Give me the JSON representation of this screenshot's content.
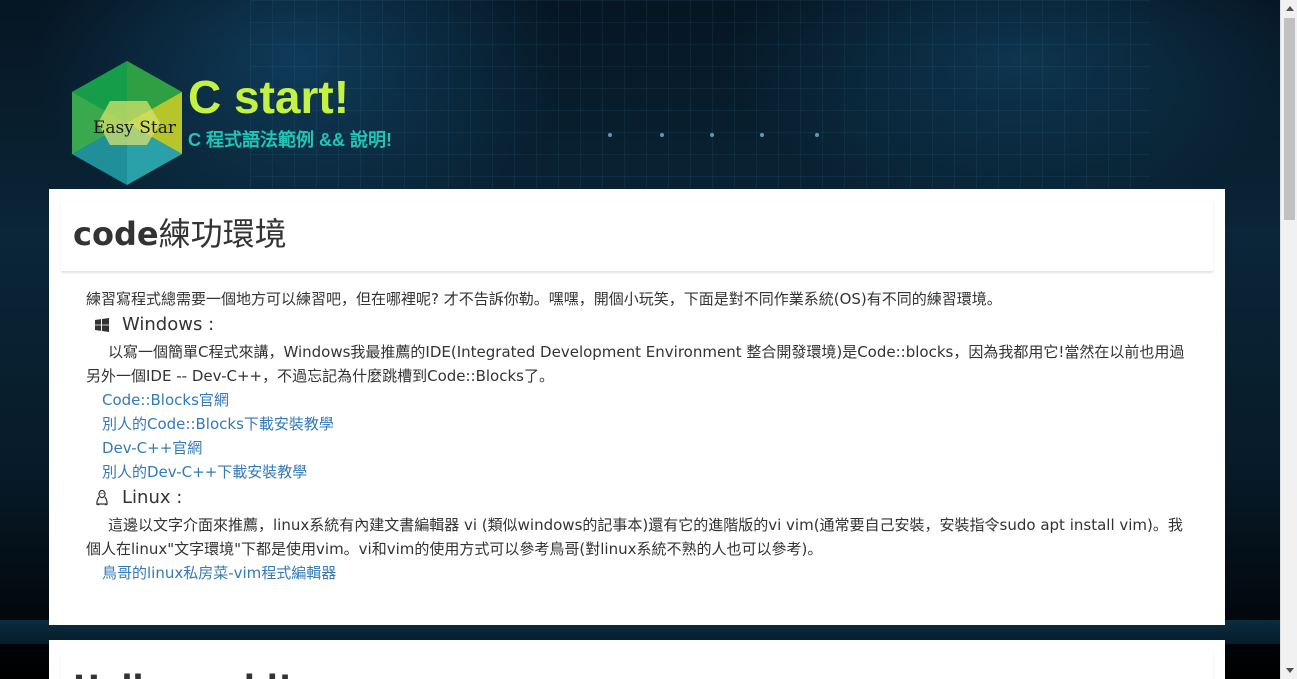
{
  "header": {
    "logo_text": "Easy Star",
    "title": "C start!",
    "subtitle": "C 程式語法範例 && 說明!"
  },
  "section1": {
    "title_bold": "code",
    "title_rest": "練功環境",
    "intro": "練習寫程式總需要一個地方可以練習吧，但在哪裡呢? 才不告訴你勒。嘿嘿，開個小玩笑，下面是對不同作業系統(OS)有不同的練習環境。",
    "windows": {
      "icon": "windows-icon",
      "heading": "Windows :",
      "text": "以寫一個簡單C程式來講，Windows我最推薦的IDE(Integrated Development Environment 整合開發環境)是Code::blocks，因為我都用它!當然在以前也用過另外一個IDE -- Dev-C++，不過忘記為什麼跳槽到Code::Blocks了。",
      "links": [
        "Code::Blocks官網",
        "別人的Code::Blocks下載安裝教學",
        "Dev-C++官網",
        "別人的Dev-C++下載安裝教學"
      ]
    },
    "linux": {
      "icon": "linux-icon",
      "heading": "Linux :",
      "text": "這邊以文字介面來推薦，linux系統有內建文書編輯器 vi (類似windows的記事本)還有它的進階版的vi vim(通常要自己安裝，安裝指令sudo apt install vim)。我個人在linux\"文字環境\"下都是使用vim。vi和vim的使用方式可以參考鳥哥(對linux系統不熟的人也可以參考)。",
      "links": [
        "鳥哥的linux私房菜-vim程式編輯器"
      ]
    }
  },
  "section2": {
    "title": "Hello world!"
  },
  "colors": {
    "title": "#c5f242",
    "subtitle": "#1fc6b6",
    "link": "#337ab7"
  }
}
